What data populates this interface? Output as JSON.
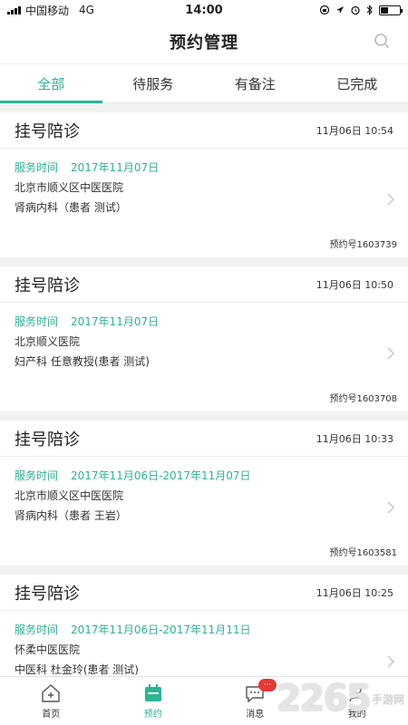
{
  "status_bar": {
    "carrier": "中国移动",
    "network": "4G",
    "time": "14:00"
  },
  "nav": {
    "title": "预约管理"
  },
  "tabs": [
    {
      "label": "全部",
      "active": true
    },
    {
      "label": "待服务",
      "active": false
    },
    {
      "label": "有备注",
      "active": false
    },
    {
      "label": "已完成",
      "active": false
    }
  ],
  "cards": [
    {
      "title": "挂号陪诊",
      "time": "11月06日 10:54",
      "service_label": "服务时间",
      "service_date": "2017年11月07日",
      "hospital": "北京市顺义区中医医院",
      "dept": "肾病内科（患者 测试）",
      "no": "预约号1603739"
    },
    {
      "title": "挂号陪诊",
      "time": "11月06日 10:50",
      "service_label": "服务时间",
      "service_date": "2017年11月07日",
      "hospital": "北京顺义医院",
      "dept": "妇产科  任意教授(患者 测试)",
      "no": "预约号1603708"
    },
    {
      "title": "挂号陪诊",
      "time": "11月06日 10:33",
      "service_label": "服务时间",
      "service_date": "2017年11月06日-2017年11月07日",
      "hospital": "北京市顺义区中医医院",
      "dept": "肾病内科（患者 王岩）",
      "no": "预约号1603581"
    },
    {
      "title": "挂号陪诊",
      "time": "11月06日 10:25",
      "service_label": "服务时间",
      "service_date": "2017年11月06日-2017年11月11日",
      "hospital": "怀柔中医医院",
      "dept": "中医科  杜金玲(患者 测试)",
      "no": ""
    }
  ],
  "tab_bar": [
    {
      "label": "首页",
      "icon": "home-icon",
      "active": false
    },
    {
      "label": "预约",
      "icon": "calendar-icon",
      "active": true
    },
    {
      "label": "消息",
      "icon": "message-icon",
      "active": false,
      "badge": "···"
    },
    {
      "label": "我的",
      "icon": "profile-icon",
      "active": false
    }
  ],
  "watermark": {
    "logo": "2265",
    "text": "手游网"
  },
  "colors": {
    "accent": "#2bb593",
    "badge": "#e53935"
  }
}
